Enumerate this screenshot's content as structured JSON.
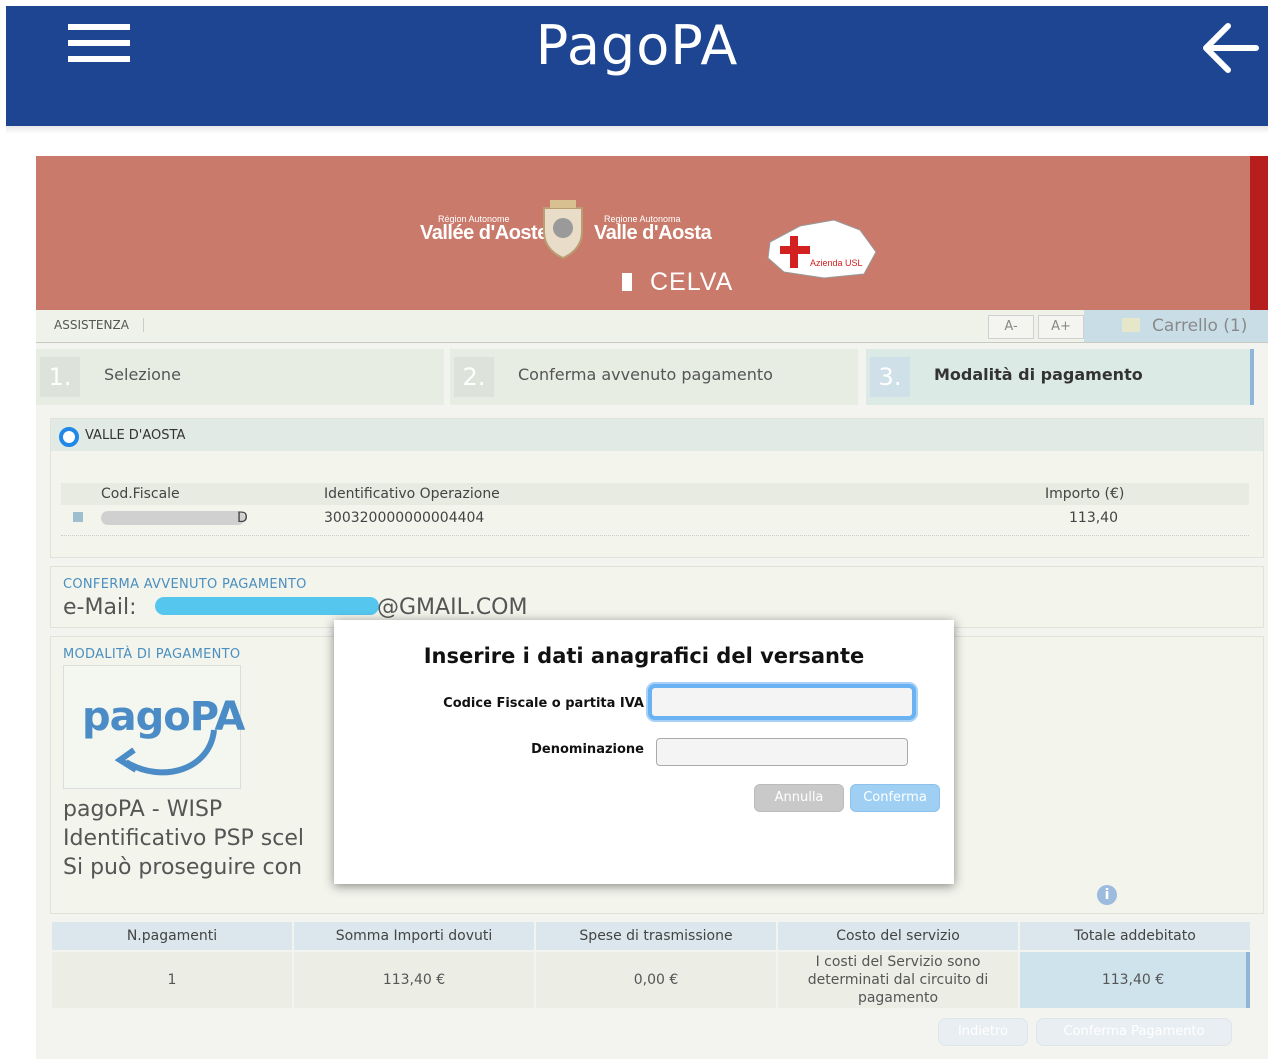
{
  "appbar": {
    "title": "PagoPA"
  },
  "banner": {
    "logo1_small": "Région Autonome",
    "logo1_big": "Vallée d'Aoste",
    "logo2_small": "Regione Autonoma",
    "logo2_big": "Valle d'Aosta",
    "celva": "CELVA",
    "usl": "Azienda USL"
  },
  "toolbar": {
    "assist": "ASSISTENZA",
    "font_minus": "A-",
    "font_plus": "A+",
    "cart": "Carrello (1)"
  },
  "steps": [
    {
      "num": "1.",
      "label": "Selezione"
    },
    {
      "num": "2.",
      "label": "Conferma avvenuto pagamento"
    },
    {
      "num": "3.",
      "label": "Modalità di pagamento"
    }
  ],
  "ente": {
    "name": "VALLE D'AOSTA",
    "columns": [
      "Cod.Fiscale",
      "Identificativo Operazione",
      "Importo (€)"
    ],
    "row": {
      "cf_tail": "D",
      "id": "300320000000004404",
      "amount": "113,40"
    }
  },
  "confirm": {
    "title": "CONFERMA AVVENUTO PAGAMENTO",
    "email_label": "e-Mail:",
    "email_suffix": "@GMAIL.COM"
  },
  "payment_mode": {
    "title": "MODALITÀ DI PAGAMENTO",
    "logo_text": "pagoPA",
    "line1": "pagoPA - WISP",
    "line2": "Identificativo PSP scel",
    "line3": "Si può proseguire con"
  },
  "summary": {
    "headers": [
      "N.pagamenti",
      "Somma Importi dovuti",
      "Spese di trasmissione",
      "Costo del servizio",
      "Totale addebitato"
    ],
    "values": [
      "1",
      "113,40 €",
      "0,00 €",
      "I costi del Servizio sono determinati dal circuito di pagamento",
      "113,40 €"
    ]
  },
  "buttons": {
    "back": "Indietro",
    "confirm_payment": "Conferma Pagamento"
  },
  "modal": {
    "title": "Inserire i dati anagrafici del versante",
    "cf_label": "Codice Fiscale o partita IVA",
    "cf_value": "",
    "name_label": "Denominazione",
    "name_value": "",
    "cancel": "Annulla",
    "confirm": "Conferma"
  },
  "colors": {
    "appbar": "#1d4591",
    "banner": "#c97a6b",
    "accent": "#4a8fbf"
  }
}
